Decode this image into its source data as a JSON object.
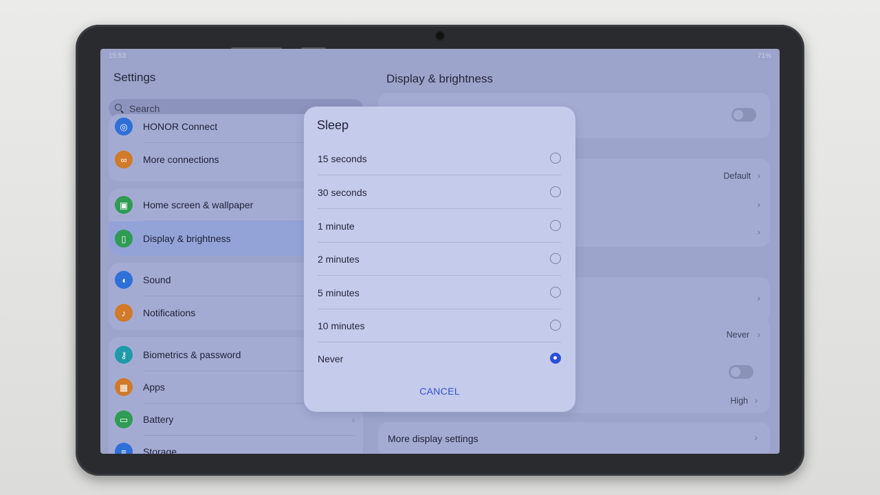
{
  "status_bar": {
    "time": "15:53",
    "battery": "71%"
  },
  "left_pane": {
    "title": "Settings",
    "search_placeholder": "Search",
    "items": [
      {
        "label": "HONOR Connect",
        "icon": "honor-connect-icon",
        "color": "#2f6fd8"
      },
      {
        "label": "More connections",
        "icon": "link-icon",
        "color": "#d07a2a"
      },
      {
        "label": "Home screen & wallpaper",
        "icon": "wallpaper-icon",
        "color": "#2f9b54"
      },
      {
        "label": "Display & brightness",
        "icon": "display-icon",
        "color": "#2f9b54"
      },
      {
        "label": "Sound",
        "icon": "speaker-icon",
        "color": "#2f6fd8"
      },
      {
        "label": "Notifications",
        "icon": "bell-icon",
        "color": "#d07a2a"
      },
      {
        "label": "Biometrics & password",
        "icon": "key-icon",
        "color": "#1f9aa8"
      },
      {
        "label": "Apps",
        "icon": "apps-icon",
        "color": "#d07a2a"
      },
      {
        "label": "Battery",
        "icon": "battery-icon",
        "color": "#2f9b54"
      },
      {
        "label": "Storage",
        "icon": "storage-icon",
        "color": "#2f6fd8"
      }
    ]
  },
  "right_pane": {
    "title": "Display & brightness",
    "values": {
      "default": "Default",
      "never": "Never",
      "high": "High"
    },
    "more_display_settings": "More display settings"
  },
  "dialog": {
    "title": "Sleep",
    "options": [
      {
        "label": "15 seconds",
        "selected": false
      },
      {
        "label": "30 seconds",
        "selected": false
      },
      {
        "label": "1 minute",
        "selected": false
      },
      {
        "label": "2 minutes",
        "selected": false
      },
      {
        "label": "5 minutes",
        "selected": false
      },
      {
        "label": "10 minutes",
        "selected": false
      },
      {
        "label": "Never",
        "selected": true
      }
    ],
    "cancel_label": "CANCEL"
  },
  "colors": {
    "accent": "#2c4fd6",
    "dim_screen": "#9da4cb",
    "dialog_bg": "#c5cbeb"
  }
}
